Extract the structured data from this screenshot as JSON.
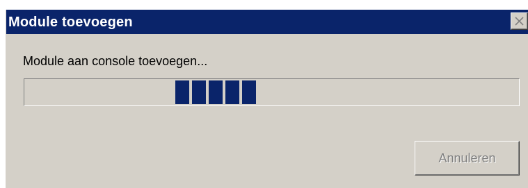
{
  "window": {
    "title": "Module toevoegen",
    "close_icon": "close-icon"
  },
  "dialog": {
    "message": "Module aan console toevoegen...",
    "progress": {
      "style": "marquee",
      "block_count": 5,
      "color": "#0a246a"
    },
    "cancel_label": "Annuleren",
    "cancel_enabled": false
  },
  "colors": {
    "titlebar": "#0a246a",
    "window_background": "#d4d0c8"
  }
}
